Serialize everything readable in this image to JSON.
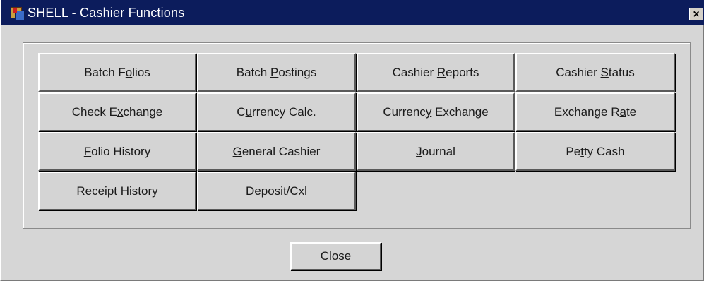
{
  "window": {
    "title": "SHELL - Cashier Functions",
    "close_glyph": "×"
  },
  "buttons": [
    {
      "pre": "Batch F",
      "u": "o",
      "post": "lios"
    },
    {
      "pre": "Batch ",
      "u": "P",
      "post": "ostings"
    },
    {
      "pre": "Cashier ",
      "u": "R",
      "post": "eports"
    },
    {
      "pre": "Cashier ",
      "u": "S",
      "post": "tatus"
    },
    {
      "pre": "Check E",
      "u": "x",
      "post": "change"
    },
    {
      "pre": "C",
      "u": "u",
      "post": "rrency Calc."
    },
    {
      "pre": "Currenc",
      "u": "y",
      "post": " Exchange"
    },
    {
      "pre": "Exchange R",
      "u": "a",
      "post": "te"
    },
    {
      "pre": "",
      "u": "F",
      "post": "olio History"
    },
    {
      "pre": "",
      "u": "G",
      "post": "eneral Cashier"
    },
    {
      "pre": "",
      "u": "J",
      "post": "ournal"
    },
    {
      "pre": "Pe",
      "u": "t",
      "post": "ty Cash"
    },
    {
      "pre": "Receipt ",
      "u": "H",
      "post": "istory"
    },
    {
      "pre": "",
      "u": "D",
      "post": "eposit/Cxl"
    }
  ],
  "close_button": {
    "pre": "",
    "u": "C",
    "post": "lose"
  }
}
